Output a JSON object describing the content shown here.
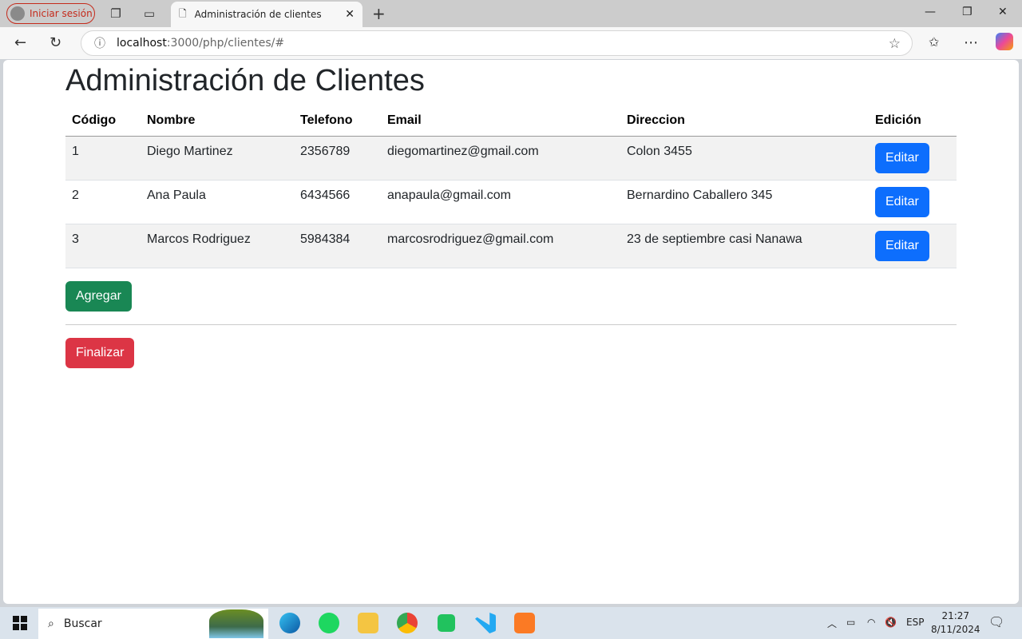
{
  "browser": {
    "profile_label": "Iniciar sesión",
    "tab_title": "Administración de clientes",
    "url_host": "localhost",
    "url_path": ":3000/php/clientes/#"
  },
  "page": {
    "title": "Administración de Clientes",
    "columns": [
      "Código",
      "Nombre",
      "Telefono",
      "Email",
      "Direccion",
      "Edición"
    ],
    "rows": [
      {
        "codigo": "1",
        "nombre": "Diego Martinez",
        "telefono": "2356789",
        "email": "diegomartinez@gmail.com",
        "direccion": "Colon 3455",
        "edit": "Editar"
      },
      {
        "codigo": "2",
        "nombre": "Ana Paula",
        "telefono": "6434566",
        "email": "anapaula@gmail.com",
        "direccion": "Bernardino Caballero 345",
        "edit": "Editar"
      },
      {
        "codigo": "3",
        "nombre": "Marcos Rodriguez",
        "telefono": "5984384",
        "email": "marcosrodriguez@gmail.com",
        "direccion": "23 de septiembre casi Nanawa",
        "edit": "Editar"
      }
    ],
    "add_label": "Agregar",
    "finish_label": "Finalizar",
    "colors": {
      "primary": "#0d6efd",
      "success": "#198754",
      "danger": "#dc3545"
    }
  },
  "taskbar": {
    "search_placeholder": "Buscar",
    "language": "ESP",
    "time": "21:27",
    "date": "8/11/2024"
  }
}
